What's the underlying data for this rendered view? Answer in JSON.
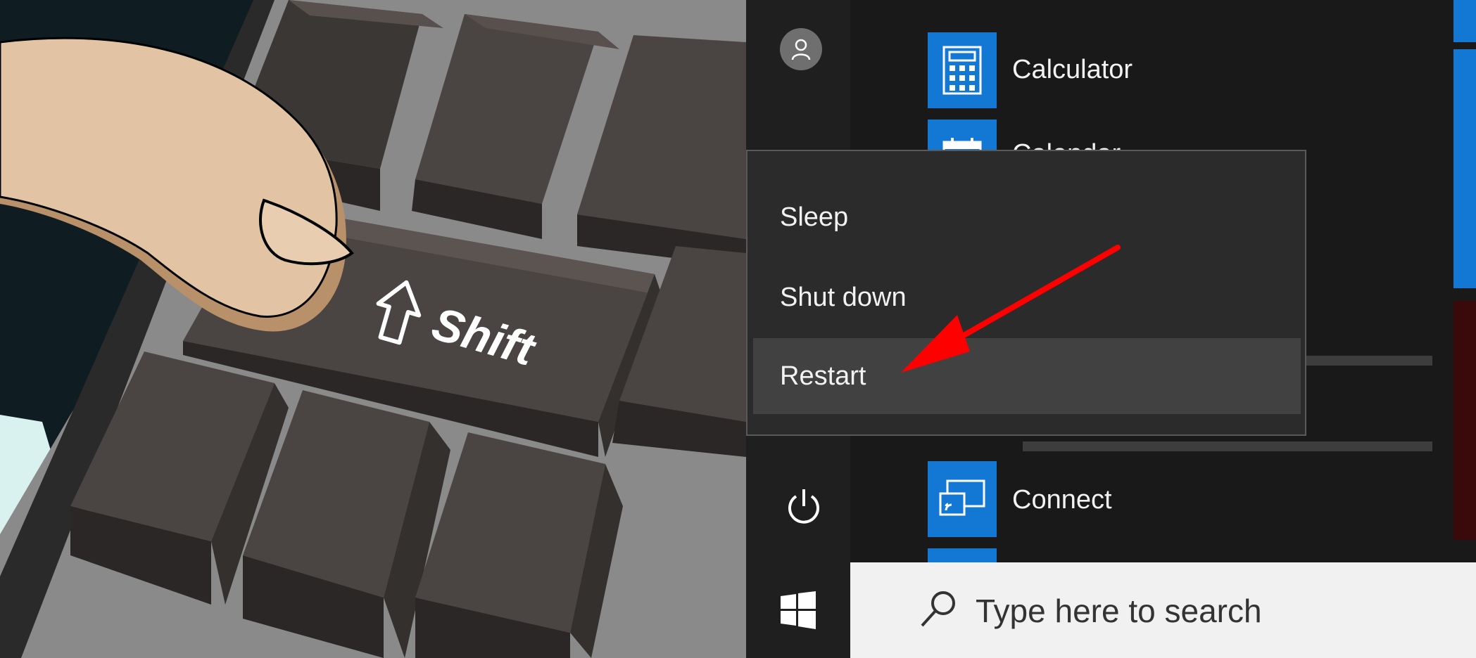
{
  "keyboard": {
    "key_label": "Shift",
    "key_icon": "shift-arrow-icon"
  },
  "start_menu": {
    "apps": [
      {
        "name": "Calculator",
        "icon": "calculator-icon"
      },
      {
        "name": "Calendar",
        "icon": "calendar-icon"
      },
      {
        "name": "Connect",
        "icon": "connect-icon"
      }
    ],
    "power_menu": {
      "items": [
        {
          "label": "Sleep"
        },
        {
          "label": "Shut down"
        },
        {
          "label": "Restart"
        }
      ],
      "highlighted": "Restart"
    },
    "rail_icons": [
      "user-avatar-icon",
      "power-icon"
    ]
  },
  "taskbar": {
    "start_icon": "windows-logo-icon",
    "search_placeholder": "Type here to search"
  },
  "colors": {
    "accent": "#1278d4",
    "annotation_arrow": "#ff0000",
    "key": "#4a4543"
  }
}
